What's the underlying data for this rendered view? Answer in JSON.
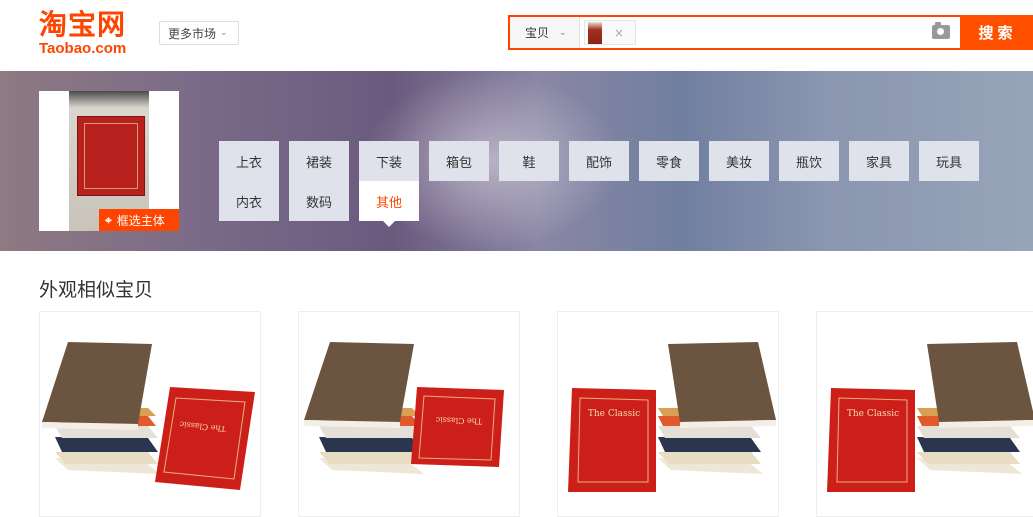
{
  "header": {
    "logo_cn": "淘宝网",
    "logo_en": "Taobao.com",
    "market_label": "更多市场"
  },
  "search": {
    "type_label": "宝贝",
    "chip_close": "×",
    "placeholder": "",
    "button_label": "搜索"
  },
  "banner": {
    "crop_label": "框选主体",
    "categories_row1": [
      "上衣",
      "裙装",
      "下装",
      "箱包",
      "鞋",
      "配饰",
      "零食",
      "美妆",
      "瓶饮",
      "家具",
      "玩具"
    ],
    "categories_row2": [
      "内衣",
      "数码",
      "其他"
    ],
    "active_category": "其他"
  },
  "results": {
    "title": "外观相似宝贝",
    "items": [
      {
        "book_title": "The Classic"
      },
      {
        "book_title": "The Classic"
      },
      {
        "book_title": "The Classic"
      },
      {
        "book_title": "The Classic"
      }
    ]
  },
  "colors": {
    "brand": "#ff4400",
    "search_button": "#ff5000",
    "category_bg": "#dfe2ea",
    "book_red": "#cc1f1a",
    "book_brown": "#6b5440"
  }
}
